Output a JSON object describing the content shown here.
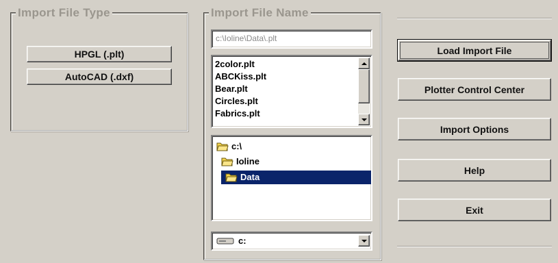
{
  "import_file_type": {
    "title": "Import File Type",
    "buttons": [
      "HPGL (.plt)",
      "AutoCAD (.dxf)"
    ]
  },
  "import_file_name": {
    "title": "Import File Name",
    "path_value": "c:\\Ioline\\Data\\.plt",
    "files": [
      "2color.plt",
      "ABCKiss.plt",
      "Bear.plt",
      "Circles.plt",
      "Fabrics.plt"
    ],
    "directories": [
      {
        "label": "c:\\",
        "icon": "open-folder-icon"
      },
      {
        "label": "Ioline",
        "icon": "open-folder-icon"
      },
      {
        "label": "Data",
        "icon": "open-folder-icon",
        "selected": true
      }
    ],
    "drive": "c:"
  },
  "actions": {
    "load": "Load Import File",
    "plotter": "Plotter Control Center",
    "options": "Import Options",
    "help": "Help",
    "exit": "Exit"
  },
  "colors": {
    "face": "#d4d0c8",
    "selection": "#0a246a",
    "folder": "#f4d44c"
  }
}
